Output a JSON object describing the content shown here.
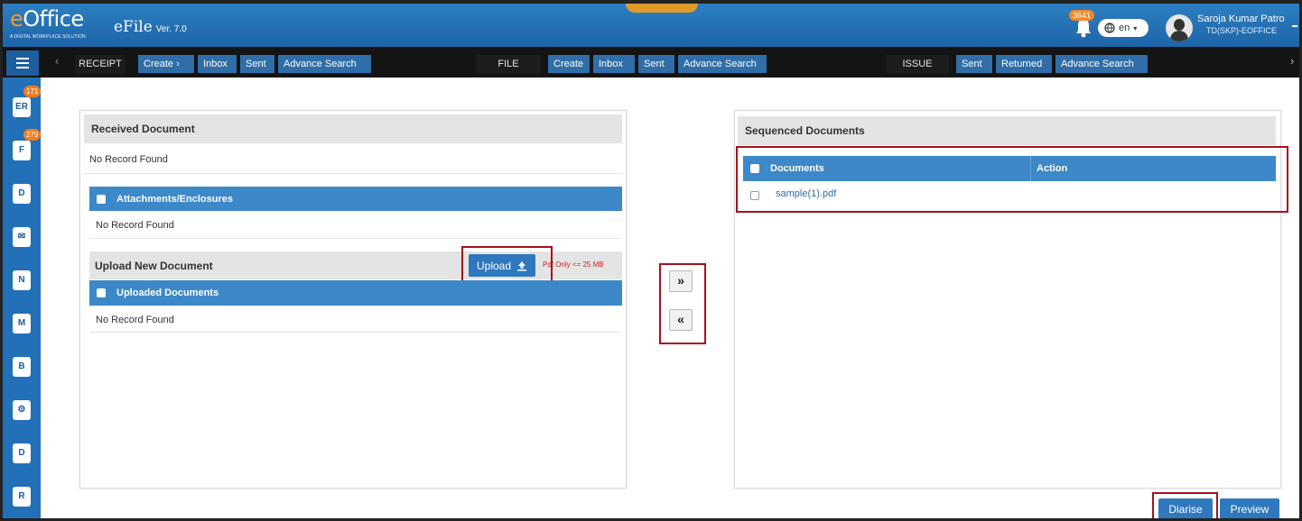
{
  "header": {
    "logo_e": "e",
    "logo_rest": "Office",
    "logo_tagline": "A DIGITAL WORKPLACE SOLUTION",
    "app_name": "eFile",
    "version": "Ver. 7.0",
    "notification_count": "3641",
    "language": "en",
    "user_name": "Saroja Kumar Patro",
    "user_role": "TD(SKP)-EOFFICE"
  },
  "menu": {
    "receipt": {
      "label": "RECEIPT",
      "create": "Create",
      "inbox": "Inbox",
      "sent": "Sent",
      "advance_search": "Advance Search"
    },
    "file": {
      "label": "FILE",
      "create": "Create",
      "inbox": "Inbox",
      "sent": "Sent",
      "advance_search": "Advance Search"
    },
    "issue": {
      "label": "ISSUE",
      "sent": "Sent",
      "returned": "Returned",
      "advance_search": "Advance Search"
    }
  },
  "sidebar": {
    "items": [
      {
        "icon": "receipt-register-icon",
        "glyph": "ER",
        "badge": "171"
      },
      {
        "icon": "file-register-icon",
        "glyph": "F",
        "badge": "279"
      },
      {
        "icon": "dak-mail-icon",
        "glyph": "D",
        "badge": ""
      },
      {
        "icon": "dispatch-icon",
        "glyph": "✉",
        "badge": ""
      },
      {
        "icon": "notice-icon",
        "glyph": "N",
        "badge": ""
      },
      {
        "icon": "movement-icon",
        "glyph": "M",
        "badge": ""
      },
      {
        "icon": "barcode-icon",
        "glyph": "B",
        "badge": ""
      },
      {
        "icon": "settings-icon",
        "glyph": "⚙",
        "badge": ""
      },
      {
        "icon": "document-icon",
        "glyph": "D",
        "badge": ""
      },
      {
        "icon": "report-icon",
        "glyph": "R",
        "badge": ""
      }
    ]
  },
  "left_panel": {
    "received_title": "Received Document",
    "received_empty": "No Record Found",
    "attachments_header": "Attachments/Enclosures",
    "attachments_empty": "No Record Found",
    "upload_title": "Upload New Document",
    "upload_button": "Upload",
    "upload_note": "Pdf Only <= 25 MB",
    "uploaded_header": "Uploaded Documents",
    "uploaded_empty": "No Record Found"
  },
  "middle": {
    "move_right": "»",
    "move_left": "«"
  },
  "right_panel": {
    "title": "Sequenced Documents",
    "col_documents": "Documents",
    "col_action": "Action",
    "rows": [
      {
        "document": "sample(1).pdf",
        "action": ""
      }
    ]
  },
  "footer": {
    "diarise_button": "Diarise",
    "preview_button": "Preview"
  },
  "colors": {
    "header_blue": "#2d7fc1",
    "table_header_blue": "#3c88c8",
    "highlight_red": "#a4121b",
    "badge_orange": "#ef7d23"
  }
}
